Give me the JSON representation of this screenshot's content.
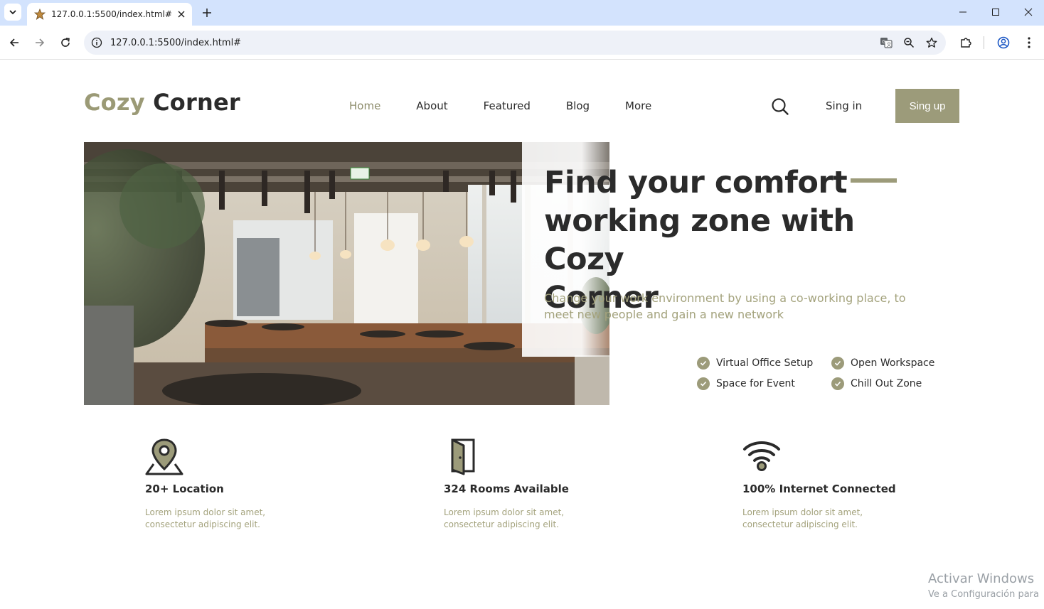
{
  "browser": {
    "tab_title": "127.0.0.1:5500/index.html#",
    "url": "127.0.0.1:5500/index.html#"
  },
  "brand": {
    "part1": "Cozy",
    "part2": "Corner"
  },
  "nav": {
    "items": [
      {
        "label": "Home",
        "active": true
      },
      {
        "label": "About"
      },
      {
        "label": "Featured"
      },
      {
        "label": "Blog"
      },
      {
        "label": "More"
      }
    ],
    "signin": "Sing in",
    "signup": "Sing up"
  },
  "hero": {
    "headline_line1": "Find your comfort",
    "headline_line2": "working zone with Cozy",
    "headline_line3": "Corner",
    "subtitle": "Change your work environment by using a co-working place, to meet new people and gain a new network",
    "features": [
      "Virtual Office Setup",
      "Open Workspace",
      "Space for Event",
      "Chill Out Zone"
    ]
  },
  "stats": [
    {
      "icon": "location-pin-icon",
      "title": "20+ Location",
      "desc_line1": "Lorem ipsum dolor sit amet,",
      "desc_line2": "consectetur adipiscing elit."
    },
    {
      "icon": "door-icon",
      "title": "324 Rooms Available",
      "desc_line1": "Lorem ipsum dolor sit amet,",
      "desc_line2": "consectetur adipiscing elit."
    },
    {
      "icon": "wifi-icon",
      "title": "100% Internet Connected",
      "desc_line1": "Lorem ipsum dolor sit amet,",
      "desc_line2": "consectetur adipiscing elit."
    }
  ],
  "watermark": {
    "line1": "Activar Windows",
    "line2": "Ve a Configuración para"
  },
  "colors": {
    "accent": "#9c9b7a",
    "text": "#2b2b2b",
    "muted": "#a3a27c"
  }
}
